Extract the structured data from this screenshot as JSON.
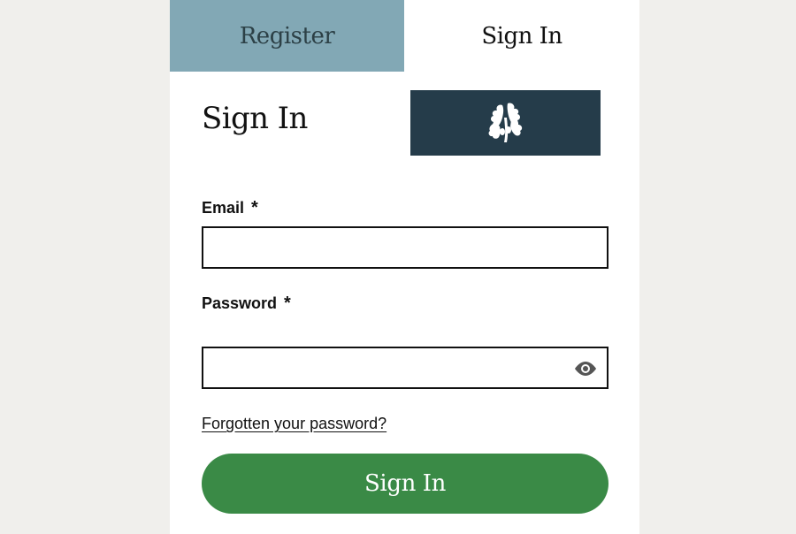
{
  "tabs": {
    "register_label": "Register",
    "signin_label": "Sign In"
  },
  "form": {
    "heading": "Sign In",
    "email_label": "Email",
    "email_value": "",
    "password_label": "Password",
    "password_value": "",
    "required_marker": "*",
    "forgot_link": "Forgotten your password?",
    "submit_label": "Sign In"
  },
  "icons": {
    "logo": "oak-leaf-logo-icon",
    "password_toggle": "eye-icon"
  },
  "colors": {
    "register_tab_bg": "#82a8b5",
    "logo_bg": "#253c4a",
    "button_bg": "#3a8a46",
    "page_bg": "#f0efec"
  }
}
